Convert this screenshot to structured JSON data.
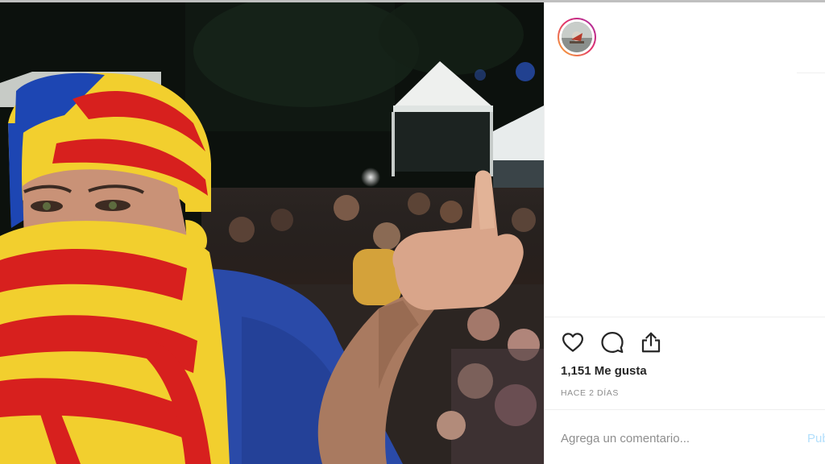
{
  "post": {
    "image_alt": "Person wrapped in a red and yellow striped flag, showing the middle finger, at a night-time rally",
    "likes_text": "1,151 Me gusta",
    "timestamp": "HACE 2 DÍAS"
  },
  "actions": {
    "like_icon": "heart-icon",
    "comment_icon": "speech-bubble-icon",
    "share_icon": "share-upload-icon"
  },
  "comment_box": {
    "placeholder": "Agrega un comentario...",
    "post_label": "Publicar"
  },
  "colors": {
    "flag_red": "#d7201e",
    "flag_yellow": "#f2cf2e",
    "text_primary": "#262626",
    "text_secondary": "#8e8e8e",
    "post_disabled": "#b2dffc"
  }
}
